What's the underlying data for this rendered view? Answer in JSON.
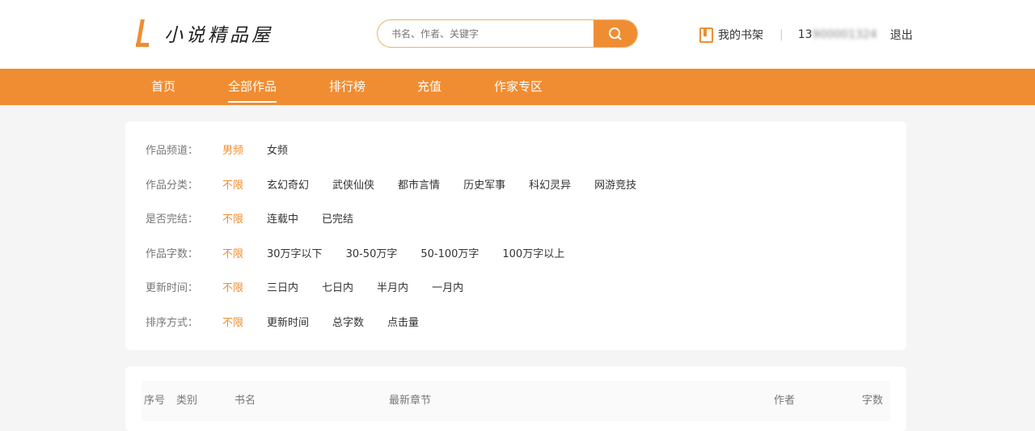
{
  "header": {
    "logo_text": "小说精品屋",
    "search_placeholder": "书名、作者、关键字",
    "bookshelf_label": "我的书架",
    "phone_visible": "13",
    "phone_blurred": "900001324",
    "logout_label": "退出"
  },
  "nav": {
    "items": [
      "首页",
      "全部作品",
      "排行榜",
      "充值",
      "作家专区"
    ],
    "active": 1
  },
  "filters": [
    {
      "label": "作品频道：",
      "options": [
        "男频",
        "女频"
      ],
      "selected": 0
    },
    {
      "label": "作品分类：",
      "options": [
        "不限",
        "玄幻奇幻",
        "武侠仙侠",
        "都市言情",
        "历史军事",
        "科幻灵异",
        "网游竞技"
      ],
      "selected": 0
    },
    {
      "label": "是否完结：",
      "options": [
        "不限",
        "连载中",
        "已完结"
      ],
      "selected": 0
    },
    {
      "label": "作品字数：",
      "options": [
        "不限",
        "30万字以下",
        "30-50万字",
        "50-100万字",
        "100万字以上"
      ],
      "selected": 0
    },
    {
      "label": "更新时间：",
      "options": [
        "不限",
        "三日内",
        "七日内",
        "半月内",
        "一月内"
      ],
      "selected": 0
    },
    {
      "label": "排序方式：",
      "options": [
        "不限",
        "更新时间",
        "总字数",
        "点击量"
      ],
      "selected": 0
    }
  ],
  "table": {
    "columns": [
      "序号",
      "类别",
      "书名",
      "最新章节",
      "作者",
      "字数"
    ]
  },
  "colors": {
    "accent": "#f08d32"
  }
}
